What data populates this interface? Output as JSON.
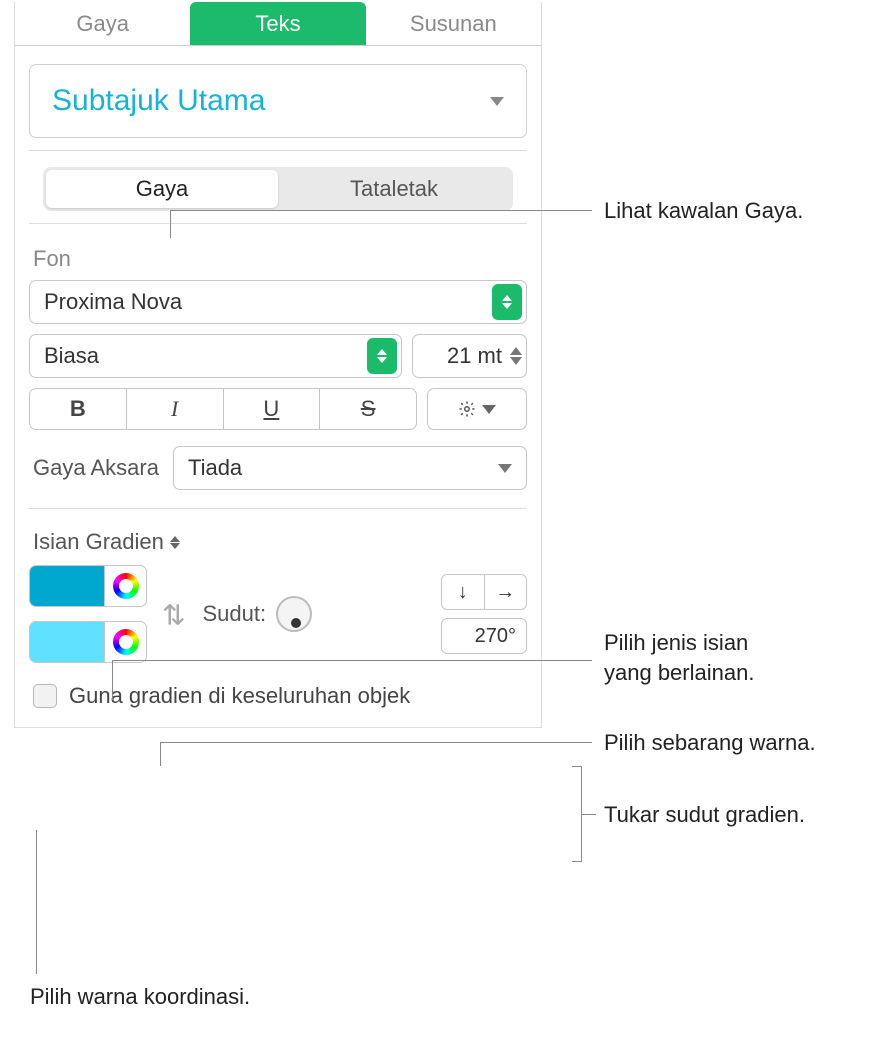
{
  "tabs": {
    "style": "Gaya",
    "text": "Teks",
    "arrange": "Susunan"
  },
  "paragraph_style": "Subtajuk Utama",
  "segmented": {
    "style": "Gaya",
    "layout": "Tataletak"
  },
  "font": {
    "section": "Fon",
    "family": "Proxima Nova",
    "weight": "Biasa",
    "size": "21 mt",
    "char_style_label": "Gaya Aksara",
    "char_style_value": "Tiada"
  },
  "fill": {
    "type_label": "Isian Gradien",
    "color1": "#00A7CF",
    "color2": "#5FE1FF",
    "angle_label": "Sudut:",
    "angle_value": "270°",
    "checkbox_label": "Guna gradien di keseluruhan objek"
  },
  "callouts": {
    "style_controls": "Lihat kawalan Gaya.",
    "fill_type": "Pilih jenis isian\nyang berlainan.",
    "any_color": "Pilih sebarang warna.",
    "angle": "Tukar sudut gradien.",
    "coord_color": "Pilih warna koordinasi."
  }
}
